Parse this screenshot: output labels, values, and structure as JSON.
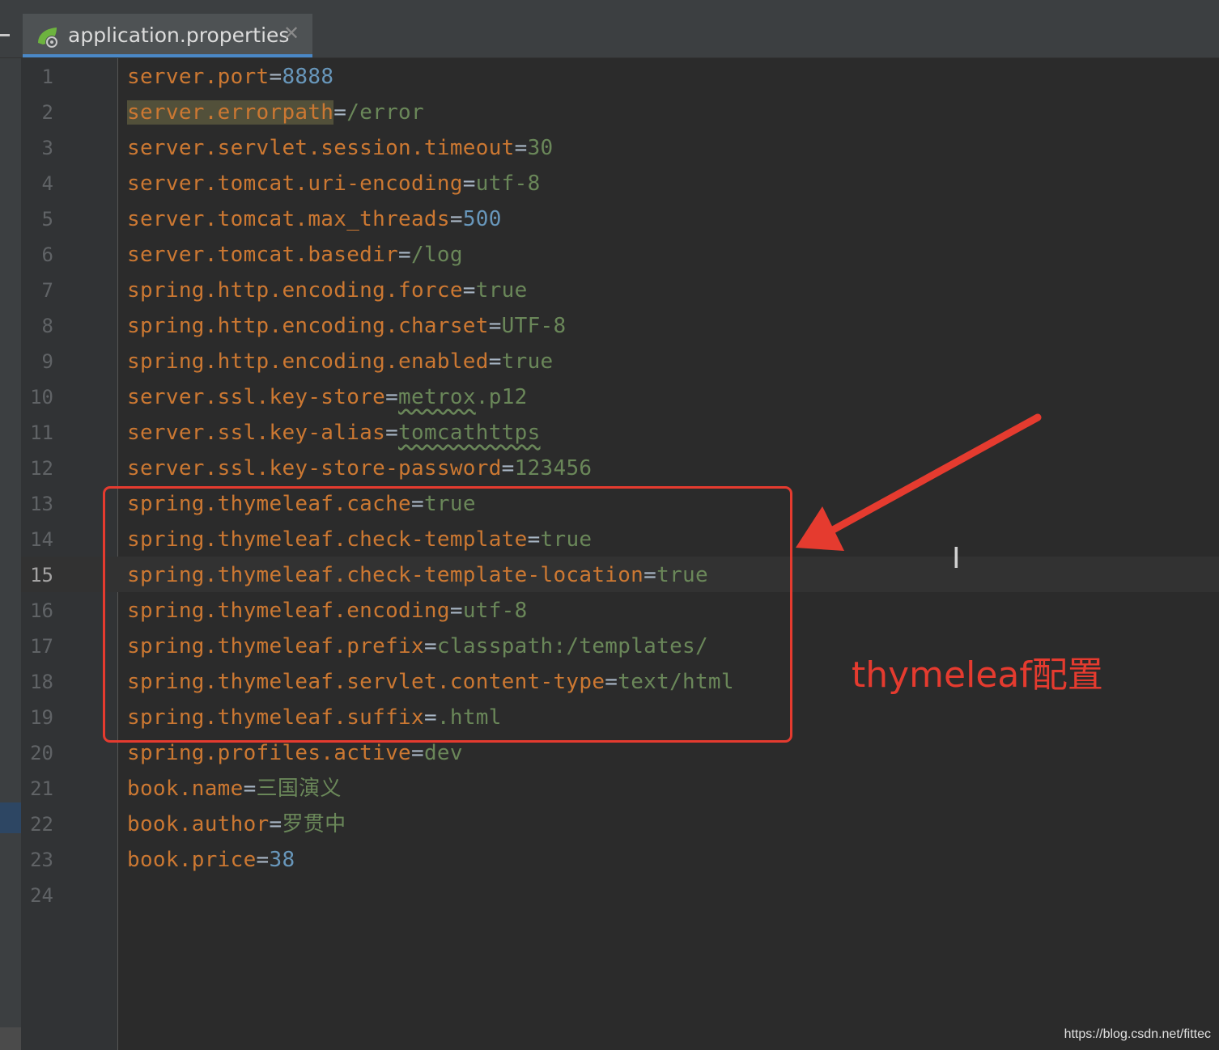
{
  "tab": {
    "label": "application.properties",
    "icon": "spring-properties-icon",
    "close_label": "✕"
  },
  "editor": {
    "current_line": 15,
    "lines": [
      {
        "n": "1",
        "key": "server.port",
        "eq": "=",
        "value": "8888",
        "vtype": "num"
      },
      {
        "n": "2",
        "key": "server.errorpath",
        "eq": "=",
        "value": "/error",
        "vtype": "str",
        "highlight": true
      },
      {
        "n": "3",
        "key": "server.servlet.session.timeout",
        "eq": "=",
        "value": "30",
        "vtype": "str"
      },
      {
        "n": "4",
        "key": "server.tomcat.uri-encoding",
        "eq": "=",
        "value": "utf-8",
        "vtype": "str"
      },
      {
        "n": "5",
        "key": "server.tomcat.max_threads",
        "eq": "=",
        "value": "500",
        "vtype": "num"
      },
      {
        "n": "6",
        "key": "server.tomcat.basedir",
        "eq": "=",
        "value": "/log",
        "vtype": "str"
      },
      {
        "n": "7",
        "key": "spring.http.encoding.force",
        "eq": "=",
        "value": "true",
        "vtype": "str"
      },
      {
        "n": "8",
        "key": "spring.http.encoding.charset",
        "eq": "=",
        "value": "UTF-8",
        "vtype": "str"
      },
      {
        "n": "9",
        "key": "spring.http.encoding.enabled",
        "eq": "=",
        "value": "true",
        "vtype": "str"
      },
      {
        "n": "10",
        "key": "server.ssl.key-store",
        "eq": "=",
        "value": "metrox.p12",
        "vtype": "str",
        "typo": "metrox",
        "rest": ".p12"
      },
      {
        "n": "11",
        "key": "server.ssl.key-alias",
        "eq": "=",
        "value": "tomcathttps",
        "vtype": "str",
        "typo": "tomcathttps",
        "rest": ""
      },
      {
        "n": "12",
        "key": "server.ssl.key-store-password",
        "eq": "=",
        "value": "123456",
        "vtype": "str"
      },
      {
        "n": "13",
        "key": "spring.thymeleaf.cache",
        "eq": "=",
        "value": "true",
        "vtype": "str"
      },
      {
        "n": "14",
        "key": "spring.thymeleaf.check-template",
        "eq": "=",
        "value": "true",
        "vtype": "str"
      },
      {
        "n": "15",
        "key": "spring.thymeleaf.check-template-location",
        "eq": "=",
        "value": "true",
        "vtype": "str"
      },
      {
        "n": "16",
        "key": "spring.thymeleaf.encoding",
        "eq": "=",
        "value": "utf-8",
        "vtype": "str"
      },
      {
        "n": "17",
        "key": "spring.thymeleaf.prefix",
        "eq": "=",
        "value": "classpath:/templates/",
        "vtype": "str"
      },
      {
        "n": "18",
        "key": "spring.thymeleaf.servlet.content-type",
        "eq": "=",
        "value": "text/html",
        "vtype": "str"
      },
      {
        "n": "19",
        "key": "spring.thymeleaf.suffix",
        "eq": "=",
        "value": ".html",
        "vtype": "str"
      },
      {
        "n": "20",
        "key": "spring.profiles.active",
        "eq": "=",
        "value": "dev",
        "vtype": "str"
      },
      {
        "n": "21",
        "key": "book.name",
        "eq": "=",
        "value": "三国演义",
        "vtype": "str"
      },
      {
        "n": "22",
        "key": "book.author",
        "eq": "=",
        "value": "罗贯中",
        "vtype": "str"
      },
      {
        "n": "23",
        "key": "book.price",
        "eq": "=",
        "value": "38",
        "vtype": "num"
      },
      {
        "n": "24",
        "key": "",
        "eq": "",
        "value": "",
        "vtype": "str"
      }
    ]
  },
  "annotation": {
    "text": "thymeleaf配置",
    "color": "#e53b2f"
  },
  "watermark": "https://blog.csdn.net/fittec",
  "colors": {
    "background": "#2b2b2b",
    "key": "#cc7832",
    "value": "#6a8759",
    "number": "#6897bb",
    "tab_underline": "#4a88c7"
  }
}
